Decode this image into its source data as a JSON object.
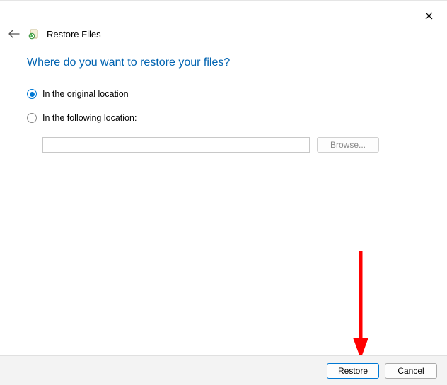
{
  "window": {
    "title": "Restore Files"
  },
  "main": {
    "heading": "Where do you want to restore your files?",
    "options": {
      "original": "In the original location",
      "following": "In the following location:"
    },
    "location_value": "",
    "browse_label": "Browse..."
  },
  "footer": {
    "restore_label": "Restore",
    "cancel_label": "Cancel"
  },
  "state": {
    "selected_option": "original"
  },
  "annotation": {
    "color": "#ff0000"
  }
}
